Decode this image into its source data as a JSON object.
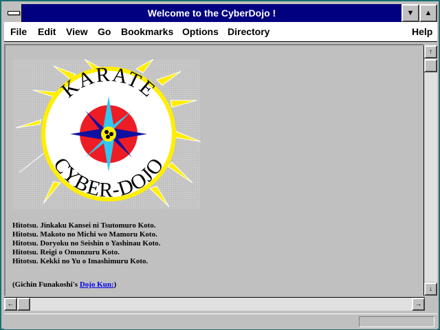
{
  "window": {
    "title": "Welcome to the CyberDojo !"
  },
  "menubar": {
    "items": [
      "File",
      "Edit",
      "View",
      "Go",
      "Bookmarks",
      "Options",
      "Directory"
    ],
    "help": "Help"
  },
  "logo": {
    "top_text": "KARATE",
    "bottom_text": "CYBER-DOJO"
  },
  "dojo_kun": [
    "Hitotsu. Jinkaku Kansei ni Tsutomuro Koto.",
    "Hitotsu. Makoto no Michi wo Mamoru Koto.",
    "Hitotsu. Doryoku no Seishin o Yashinau Koto.",
    "Hitotsu. Reigi o Omonzuru Koto.",
    "Hitotsu. Kekki no Yu o Imashimuru Koto."
  ],
  "credit": {
    "prefix": "(Gichin Funakoshi's ",
    "link": "Dojo Kun:",
    "suffix": ")"
  },
  "colors": {
    "title_bar": "#000080",
    "link": "#0000ee",
    "logo_red": "#ee1c24",
    "logo_yellow": "#ffee00",
    "logo_cyan": "#30c8f0",
    "logo_blue": "#1010a0"
  },
  "icons": {
    "minimize": "triangle-down-icon",
    "maximize": "triangle-up-icon",
    "system_menu": "system-menu-icon"
  }
}
